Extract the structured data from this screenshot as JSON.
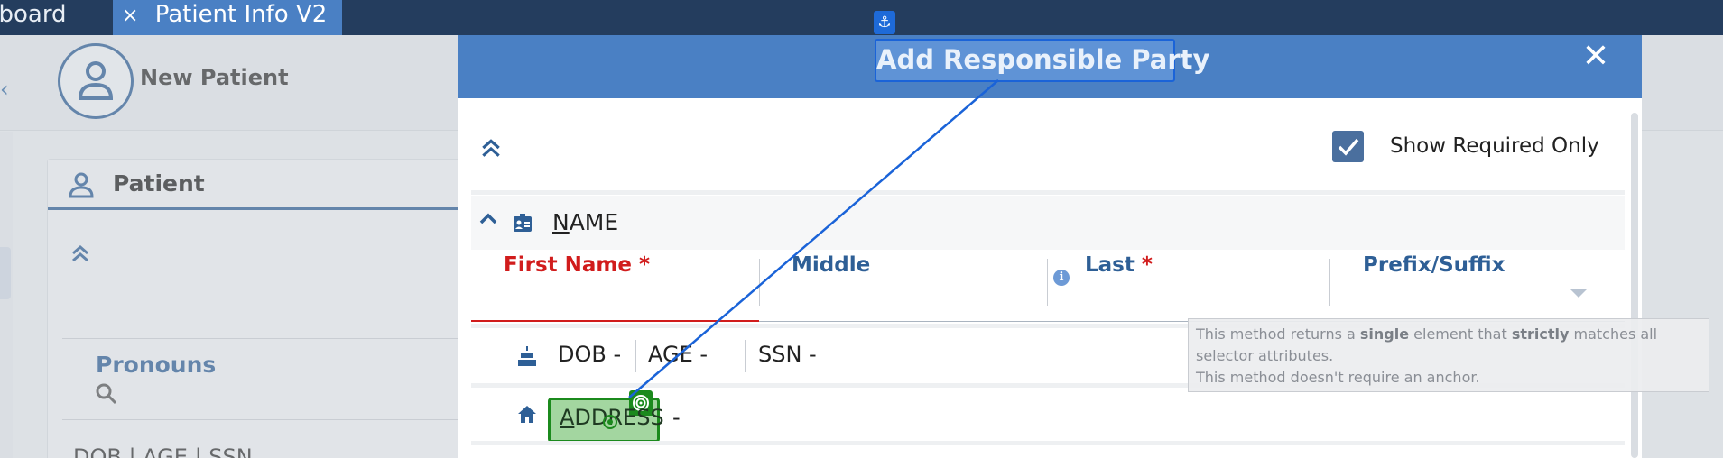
{
  "tabs": [
    {
      "label": "hboard"
    },
    {
      "label": "Patient Info V2",
      "close": "×"
    }
  ],
  "header": {
    "new_patient": "New Patient"
  },
  "patient_panel": {
    "title": "Patient",
    "pronouns": "Pronouns",
    "summary": "DOB | AGE | SSN"
  },
  "modal": {
    "title": "Add Responsible Party",
    "close": "✕",
    "show_required_only": "Show Required Only",
    "show_required_checked": true,
    "name_section": {
      "label_first": "N",
      "label_rest": "AME"
    },
    "fields": {
      "first_name": "First Name",
      "middle": "Middle",
      "last": "Last",
      "prefix_suffix": "Prefix/Suffix",
      "required_mark": "*",
      "info": "i"
    },
    "dob_row": {
      "dob": "DOB -",
      "age": "AGE -",
      "ssn": "SSN -"
    },
    "address": {
      "first": "A",
      "rest": "DDRESS",
      "dash": "-"
    }
  },
  "tooltip": {
    "p1": "This method returns a ",
    "b1": "single",
    "p2": " element that ",
    "b2": "strictly",
    "p3": " matches all selector attributes.",
    "line2": "This method doesn't require an anchor."
  },
  "colors": {
    "accent": "#4a80c4",
    "navy": "#243d5e",
    "required": "#d11c1c",
    "highlight": "#1b8a1d"
  },
  "icons": [
    "anchor-icon",
    "target-icon",
    "user-icon",
    "search-icon",
    "cake-icon",
    "home-icon",
    "id-card-icon",
    "check-icon"
  ]
}
